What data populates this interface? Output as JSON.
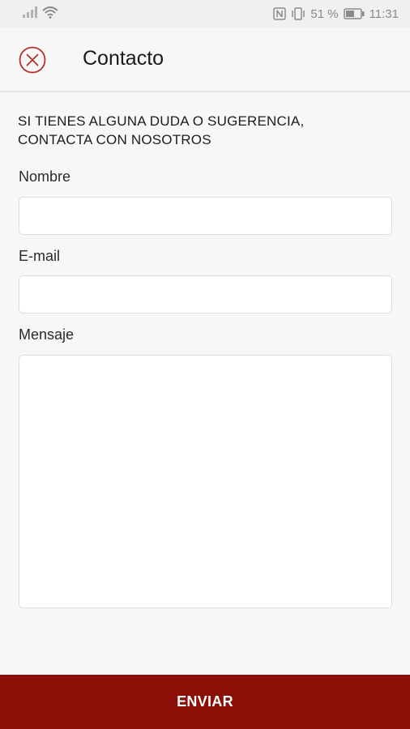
{
  "statusbar": {
    "battery_percent": "51 %",
    "time": "11:31",
    "icons": [
      "signal-icon",
      "wifi-icon",
      "nfc-icon",
      "vibrate-icon",
      "battery-icon"
    ]
  },
  "appbar": {
    "title": "Contacto",
    "close_icon": "close-circle-icon"
  },
  "form": {
    "intro_line1": "SI TIENES ALGUNA DUDA O SUGERENCIA,",
    "intro_line2": "CONTACTA CON NOSOTROS",
    "name_label": "Nombre",
    "name_value": "",
    "email_label": "E-mail",
    "email_value": "",
    "message_label": "Mensaje",
    "message_value": ""
  },
  "actions": {
    "send_label": "ENVIAR"
  },
  "colors": {
    "accent": "#8b0f06",
    "close_icon": "#b5312a",
    "background": "#f7f7f7"
  }
}
